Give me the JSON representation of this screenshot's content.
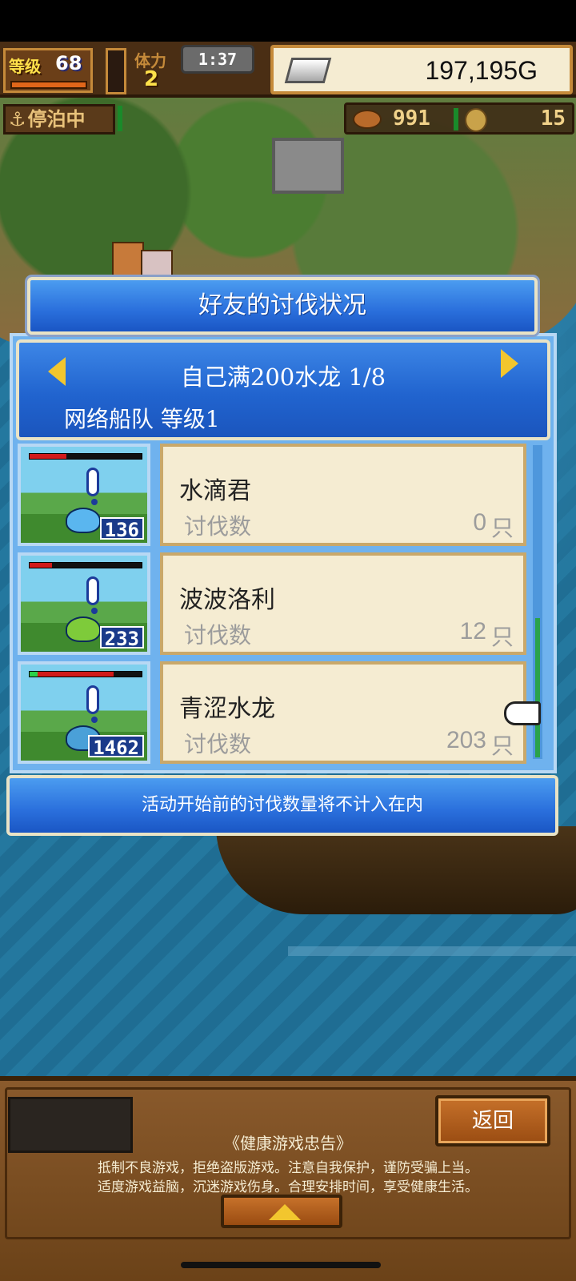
{
  "hud": {
    "level_label": "等级",
    "level_value": "68",
    "stamina_label": "体力",
    "stamina_value": "2",
    "timer": "1:37",
    "gold": "197,195G",
    "dock_status": "停泊中",
    "food": "991",
    "coins": "15"
  },
  "dialog": {
    "title": "好友的讨伐状况",
    "event_title": "自己满200水龙 1/8",
    "fleet_label": "网络船队 等级1",
    "monsters": [
      {
        "name": "水滴君",
        "kill_label": "讨伐数",
        "count": "0",
        "unit": "只",
        "badge": "136",
        "hp_fill_fraction": 0.33,
        "color": "#5ab6ef"
      },
      {
        "name": "波波洛利",
        "kill_label": "讨伐数",
        "count": "12",
        "unit": "只",
        "badge": "233",
        "hp_fill_fraction": 0.2,
        "color": "#7ecb3a"
      },
      {
        "name": "青涩水龙",
        "kill_label": "讨伐数",
        "count": "203",
        "unit": "只",
        "badge": "1462",
        "hp_fill_fraction": 0.75,
        "color": "#4aa0d8"
      }
    ],
    "notice": "活动开始前的讨伐数量将不计入在内"
  },
  "bottom": {
    "back_label": "返回",
    "health_title": "《健康游戏忠告》",
    "health_line1": "抵制不良游戏，拒绝盗版游戏。注意自我保护，谨防受骗上当。",
    "health_line2": "适度游戏益脑，沉迷游戏伤身。合理安排时间，享受健康生活。"
  }
}
